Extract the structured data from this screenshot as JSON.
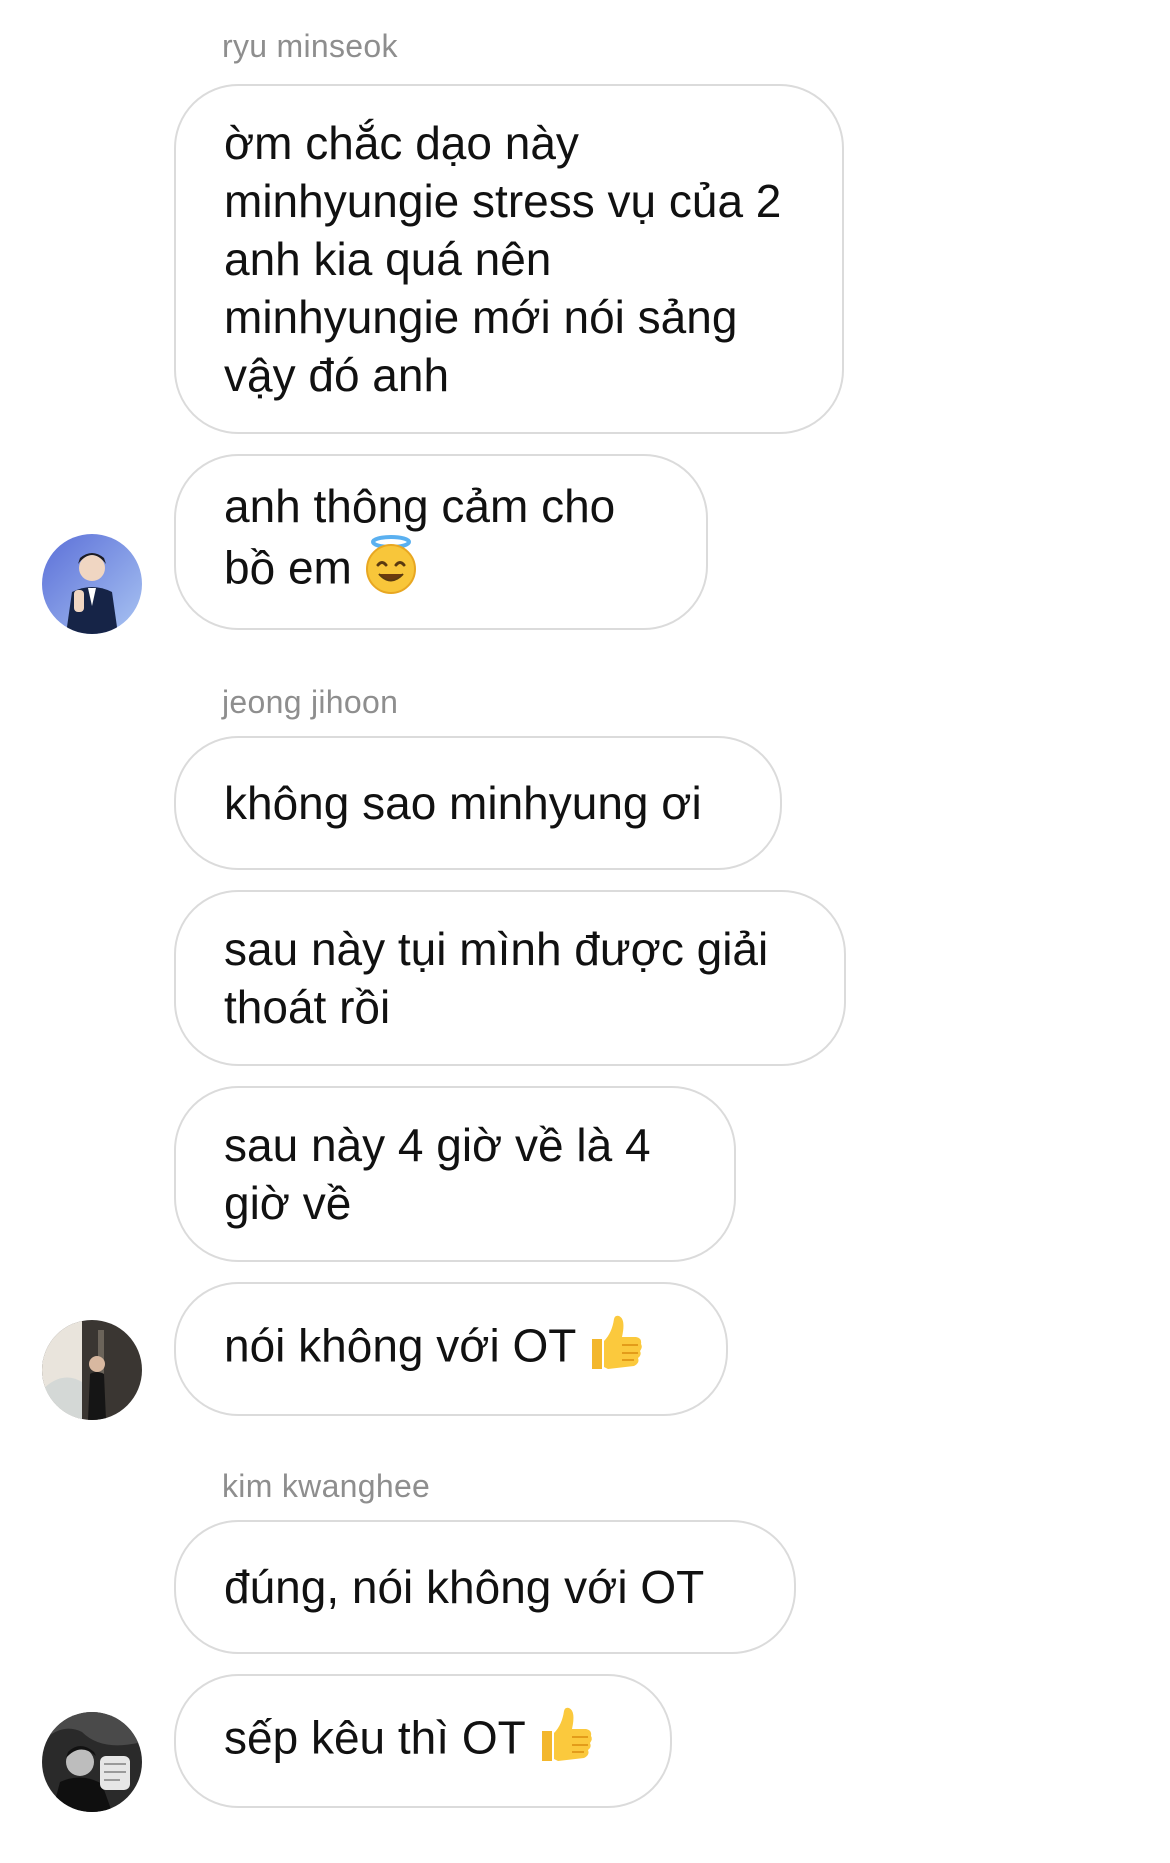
{
  "thread": {
    "groups": [
      {
        "sender": "ryu minseok",
        "messages": [
          "ờm chắc dạo này minhyungie stress vụ của 2 anh kia quá nên minhyungie mới nói sảng vậy đó anh",
          "anh thông cảm cho bồ em"
        ],
        "emoji": [
          "smiling-face-with-halo"
        ]
      },
      {
        "sender": "jeong jihoon",
        "messages": [
          "không sao minhyung ơi",
          "sau này tụi mình được giải thoát rồi",
          "sau này 4 giờ về là 4 giờ về",
          "nói không với OT"
        ],
        "emoji": [
          "thumbs-up"
        ]
      },
      {
        "sender": "kim kwanghee",
        "messages": [
          "đúng, nói không với OT",
          "sếp kêu thì OT"
        ],
        "emoji": [
          "thumbs-up"
        ]
      }
    ]
  },
  "colors": {
    "bubble_border": "#dbdbdb",
    "sender_name": "#8e8e8e",
    "text": "#111111",
    "background": "#ffffff"
  }
}
